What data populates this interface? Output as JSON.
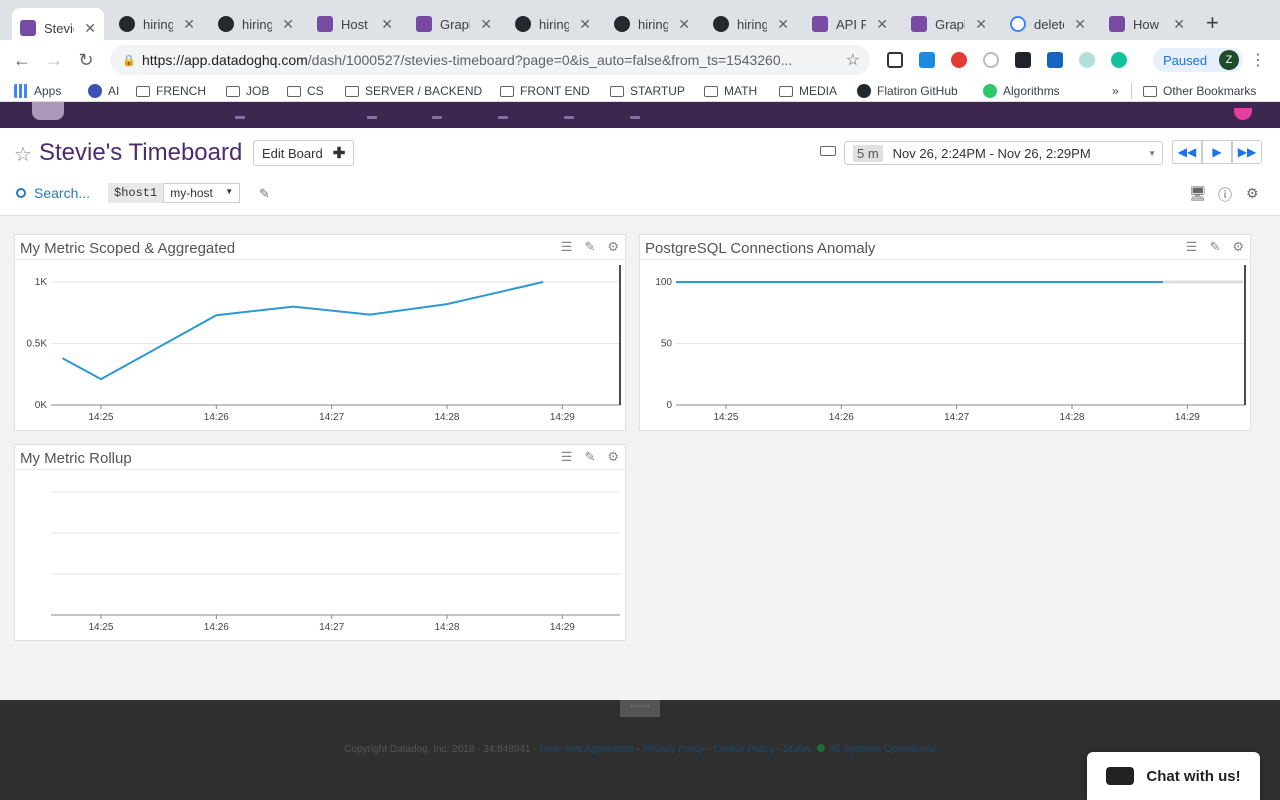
{
  "tabs": [
    {
      "label": "Stevie",
      "type": "dd",
      "active": true
    },
    {
      "label": "hiring",
      "type": "gh"
    },
    {
      "label": "hiring",
      "type": "gh"
    },
    {
      "label": "Host r",
      "type": "dd"
    },
    {
      "label": "Graph",
      "type": "dd"
    },
    {
      "label": "hiring",
      "type": "gh"
    },
    {
      "label": "hiring",
      "type": "gh"
    },
    {
      "label": "hiring",
      "type": "gh"
    },
    {
      "label": "API Re",
      "type": "dd"
    },
    {
      "label": "Graph",
      "type": "dd"
    },
    {
      "label": "delete",
      "type": "gg"
    },
    {
      "label": "How d",
      "type": "dd"
    }
  ],
  "browser": {
    "url_host": "https://app.datadoghq.com",
    "url_path": "/dash/1000527/stevies-timeboard?page=0&is_auto=false&from_ts=1543260...",
    "paused_label": "Paused",
    "avatar_letter": "Z"
  },
  "bookmarks": [
    {
      "label": "Apps"
    },
    {
      "label": "AI"
    },
    {
      "label": "FRENCH"
    },
    {
      "label": "JOB"
    },
    {
      "label": "CS"
    },
    {
      "label": "SERVER / BACKEND"
    },
    {
      "label": "FRONT END"
    },
    {
      "label": "STARTUP"
    },
    {
      "label": "MATH"
    },
    {
      "label": "MEDIA"
    },
    {
      "label": "Flatiron GitHub"
    },
    {
      "label": "Algorithms"
    },
    {
      "label": "Other Bookmarks"
    }
  ],
  "dashboard": {
    "title": "Stevie's Timeboard",
    "edit_board_label": "Edit Board",
    "time_span": "5 m",
    "time_range": "Nov 26, 2:24PM - Nov 26, 2:29PM",
    "search_placeholder": "Search...",
    "template_var_name": "$host1",
    "template_var_value": "my-host"
  },
  "widgets": [
    {
      "title": "My Metric Scoped & Aggregated"
    },
    {
      "title": "PostgreSQL Connections Anomaly"
    },
    {
      "title": "My Metric Rollup"
    }
  ],
  "chart_data": [
    {
      "type": "line",
      "title": "My Metric Scoped & Aggregated",
      "x": [
        "14:24:40",
        "14:25",
        "14:26",
        "14:26:40",
        "14:27:20",
        "14:28",
        "14:28:50"
      ],
      "x_ticks": [
        "14:25",
        "14:26",
        "14:27",
        "14:28",
        "14:29"
      ],
      "y_ticks": [
        "0K",
        "0.5K",
        "1K"
      ],
      "series": [
        {
          "values": [
            380,
            210,
            730,
            800,
            735,
            820,
            1000
          ]
        }
      ],
      "ylim": [
        0,
        1000
      ],
      "color": "#2a9ad1"
    },
    {
      "type": "line",
      "title": "PostgreSQL Connections Anomaly",
      "x_ticks": [
        "14:25",
        "14:26",
        "14:27",
        "14:28",
        "14:29"
      ],
      "y_ticks": [
        "0",
        "50",
        "100"
      ],
      "series": [
        {
          "values": [
            100,
            100,
            100,
            100,
            100,
            100
          ]
        }
      ],
      "ylim": [
        0,
        100
      ],
      "color": "#2a9ad1"
    },
    {
      "type": "line",
      "title": "My Metric Rollup",
      "x_ticks": [
        "14:25",
        "14:26",
        "14:27",
        "14:28",
        "14:29"
      ],
      "series": []
    }
  ],
  "footer": {
    "copyright": "Copyright Datadog, Inc. 2018 - 34.848941 -",
    "links": [
      "Free-Trial Agreement",
      "Privacy Policy",
      "Cookie Policy",
      "Status"
    ],
    "status_text": "All Systems Operational",
    "chat_label": "Chat with us!"
  }
}
